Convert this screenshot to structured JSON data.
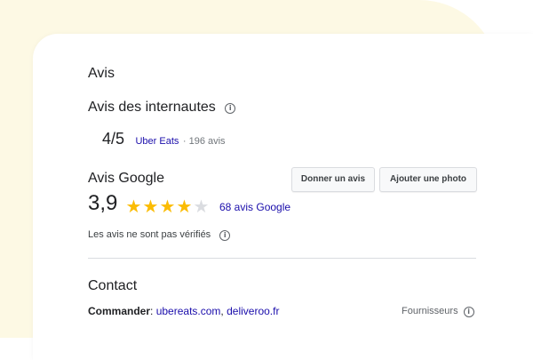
{
  "reviews": {
    "title": "Avis",
    "web_reviews_title": "Avis des internautes",
    "web_score": "4/5",
    "web_source": "Uber Eats",
    "web_count": "· 196 avis"
  },
  "google": {
    "title": "Avis Google",
    "give_review_label": "Donner un avis",
    "add_photo_label": "Ajouter une photo",
    "rating": "3,9",
    "stars_filled": 4,
    "stars_total": 5,
    "review_count_link": "68 avis Google",
    "unverified_note": "Les avis ne sont pas vérifiés"
  },
  "contact": {
    "title": "Contact",
    "order_label": "Commander",
    "order_sep": ":",
    "link1": "ubereats.com",
    "comma": ",",
    "link2": "deliveroo.fr",
    "providers": "Fournisseurs"
  },
  "colors": {
    "star_filled": "#fbbc04",
    "star_empty": "#dadce0",
    "link": "#1a0dab",
    "background_blob": "#fdf9e4"
  },
  "icons": {
    "info": "info-icon",
    "star": "star-icon"
  }
}
